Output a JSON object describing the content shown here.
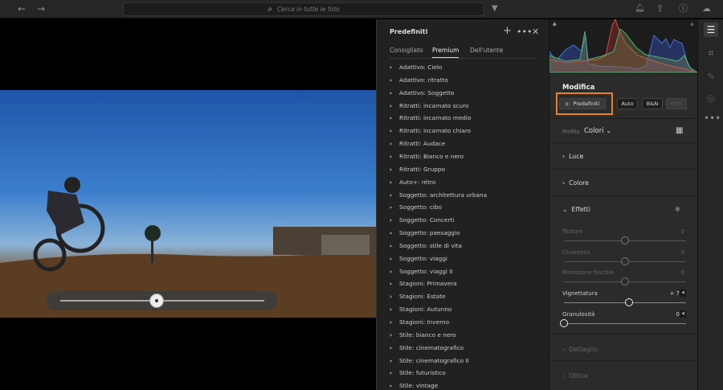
{
  "topbar": {
    "search_placeholder": "Cerca in tutte le foto",
    "icons": [
      "arrow-left-icon",
      "arrow-right-icon",
      "search-icon",
      "filter-icon",
      "bell-icon",
      "share-icon",
      "help-icon",
      "cloud-sync-icon"
    ]
  },
  "presets": {
    "title": "Predefiniti",
    "tabs": [
      "Consigliato",
      "Premium",
      "Dell'utente"
    ],
    "active_tab": "Premium",
    "items": [
      "Adattivo: Cielo",
      "Adattivo: ritratto",
      "Adattivo: Soggetto",
      "Ritratti: incarnato scuro",
      "Ritratti: incarnato medio",
      "Ritratti: incarnato chiaro",
      "Ritratti: Audace",
      "Ritratti: Bianco e nero",
      "Ritratti: Gruppo",
      "Auto+: rétro",
      "Soggetto: architettura urbana",
      "Soggetto: cibo",
      "Soggetto: Concerti",
      "Soggetto: paesaggio",
      "Soggetto: stile di vita",
      "Soggetto: viaggi",
      "Soggetto: viaggi II",
      "Stagioni: Primavera",
      "Stagioni: Estate",
      "Stagioni: Autunno",
      "Stagioni: Inverno",
      "Stile: bianco e nero",
      "Stile: cinematografico",
      "Stile: cinematografico II",
      "Stile: futuristico",
      "Stile: vintage"
    ]
  },
  "edit": {
    "title": "Modifica",
    "buttons": {
      "presets": "Predefiniti",
      "auto": "Auto",
      "bw": "B&N",
      "hdr": "HDR"
    },
    "profile_label": "Profilo",
    "profile_value": "Colori",
    "sections": {
      "light": "Luce",
      "color": "Colore",
      "effects": "Effetti",
      "detail": "Dettaglio",
      "optics": "Ottica"
    },
    "sliders": [
      {
        "label": "Texture",
        "value": "0",
        "fraction": 0.5,
        "enabled": false
      },
      {
        "label": "Chiarezza",
        "value": "0",
        "fraction": 0.5,
        "enabled": false
      },
      {
        "label": "Rimozione foschia",
        "value": "0",
        "fraction": 0.5,
        "enabled": false
      },
      {
        "label": "Vignettatura",
        "value": "+ 7",
        "fraction": 0.535,
        "enabled": true
      },
      {
        "label": "Granulosità",
        "value": "0",
        "fraction": 0.0,
        "enabled": true
      }
    ]
  },
  "colors": {
    "accent": "#e8822a"
  }
}
